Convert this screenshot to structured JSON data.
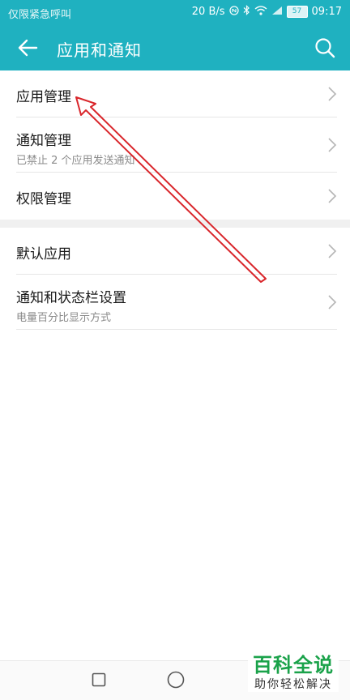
{
  "status_bar": {
    "carrier_text": "仅限紧急呼叫",
    "net_speed": "20 B/s",
    "battery_level": "57",
    "time": "09:17",
    "icons": [
      "bluetooth-icon",
      "nfc-icon",
      "wifi-icon",
      "signal-icon",
      "battery-icon"
    ]
  },
  "header": {
    "title": "应用和通知",
    "back_icon": "back-arrow-icon",
    "search_icon": "search-icon",
    "background_color": "#1fb1c0"
  },
  "settings": {
    "group1": [
      {
        "title": "应用管理",
        "subtitle": ""
      },
      {
        "title": "通知管理",
        "subtitle": "已禁止 2 个应用发送通知"
      },
      {
        "title": "权限管理",
        "subtitle": ""
      }
    ],
    "group2": [
      {
        "title": "默认应用",
        "subtitle": ""
      },
      {
        "title": "通知和状态栏设置",
        "subtitle": "电量百分比显示方式"
      }
    ]
  },
  "annotation": {
    "color": "#d9262b",
    "target": "应用管理"
  },
  "navbar": {
    "buttons": [
      "recent-apps-button",
      "home-button",
      "back-button"
    ]
  },
  "watermark": {
    "main": "百科全说",
    "sub": "助你轻松解决",
    "color": "#1aa24a"
  }
}
